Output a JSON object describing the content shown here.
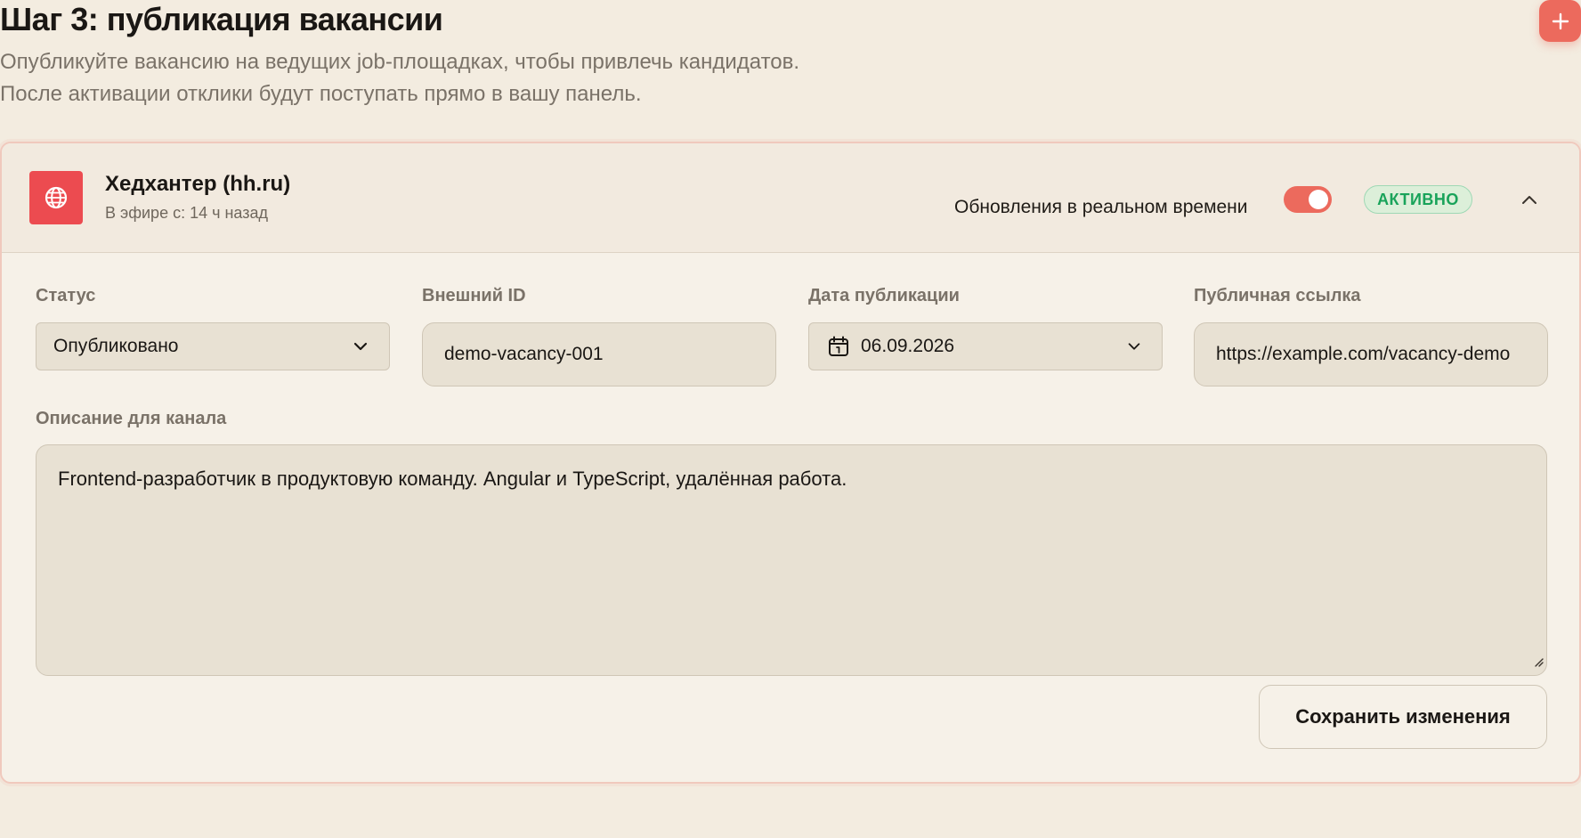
{
  "page": {
    "title": "Шаг 3: публикация вакансии",
    "subtitle_line1": "Опубликуйте вакансию на ведущих job-площадках, чтобы привлечь кандидатов.",
    "subtitle_line2": "После активации отклики будут поступать прямо в вашу панель.",
    "fab_icon": "plus-icon"
  },
  "channel": {
    "name": "Хедхантер (hh.ru)",
    "meta": "В эфире с: 14 ч назад",
    "logo_icon": "globe-icon",
    "realtime_label": "Обновления в реальном времени",
    "realtime_enabled": true,
    "status_badge": "АКТИВНО",
    "expanded": true
  },
  "fields": {
    "status_label": "Статус",
    "status_value": "Опубликовано",
    "external_id_label": "Внешний ID",
    "external_id_value": "demo-vacancy-001",
    "date_label": "Дата публикации",
    "date_value": "06.09.2026",
    "link_label": "Публичная ссылка",
    "link_value": "https://example.com/vacancy-demo",
    "description_label": "Описание для канала",
    "description_value": "Frontend-разработчик в продуктовую команду. Angular и TypeScript, удалённая работа."
  },
  "actions": {
    "save_label": "Сохранить изменения"
  },
  "colors": {
    "background": "#f3ece0",
    "accent": "#ec6a5d",
    "logo": "#ec4b50",
    "badge_text": "#19a35a",
    "badge_bg": "#dcefd9",
    "field_bg": "#e8e1d3"
  }
}
